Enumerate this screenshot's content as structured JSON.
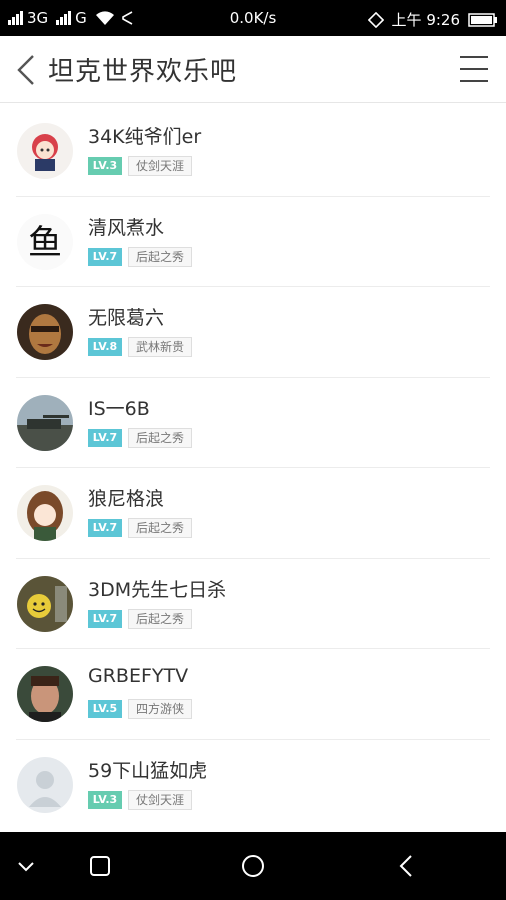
{
  "status_bar": {
    "network_1": "3G",
    "network_2": "G",
    "speed": "0.0K/s",
    "time": "上午 9:26"
  },
  "header": {
    "title": "坦克世界欢乐吧"
  },
  "users": [
    {
      "name": "34K纯爷们er",
      "level": "LV.3",
      "rank": "仗剑天涯",
      "avatar": "anime-girl-red-hair"
    },
    {
      "name": "清风煮水",
      "level": "LV.7",
      "rank": "后起之秀",
      "avatar": "calligraphy-fish"
    },
    {
      "name": "无限葛六",
      "level": "LV.8",
      "rank": "武林新贵",
      "avatar": "man-face-closeup"
    },
    {
      "name": "IS一6B",
      "level": "LV.7",
      "rank": "后起之秀",
      "avatar": "tank-landscape"
    },
    {
      "name": "狼尼格浪",
      "level": "LV.7",
      "rank": "后起之秀",
      "avatar": "anime-girl-brown-hair"
    },
    {
      "name": "3DM先生七日杀",
      "level": "LV.7",
      "rank": "后起之秀",
      "avatar": "smiley-poster"
    },
    {
      "name": "GRBEFYTV",
      "level": "LV.5",
      "rank": "四方游侠",
      "avatar": "man-portrait"
    },
    {
      "name": "59下山猛如虎",
      "level": "LV.3",
      "rank": "仗剑天涯",
      "avatar": "default-avatar"
    }
  ],
  "colors": {
    "level_badge": "#5cc6d6",
    "level_badge_low": "#66ccb0"
  }
}
